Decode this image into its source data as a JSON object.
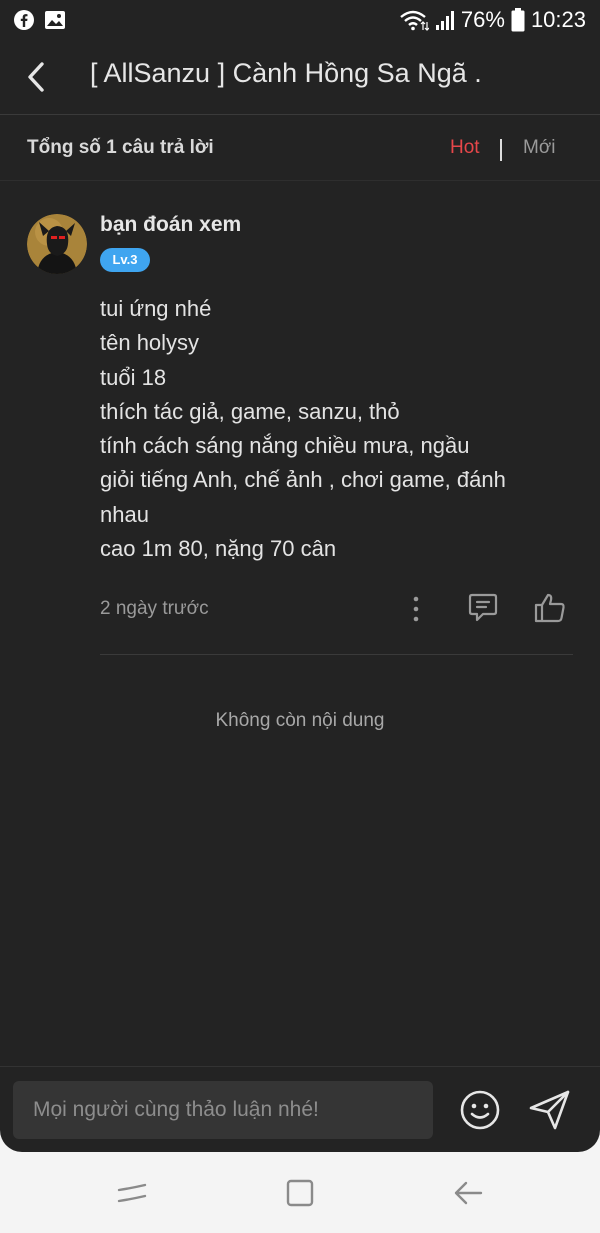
{
  "status_bar": {
    "battery": "76%",
    "time": "10:23",
    "left_icons": [
      "facebook-icon",
      "gallery-icon"
    ],
    "right_icons": [
      "wifi-icon",
      "signal-icon",
      "battery-icon"
    ]
  },
  "app_bar": {
    "title": "[ AllSanzu ] Cành Hồng Sa Ngã ."
  },
  "answers_bar": {
    "total": "Tổng số 1 câu trả lời",
    "sort_hot": "Hot",
    "sort_new": "Mới",
    "active_sort_color": "#e8474a"
  },
  "answer": {
    "username": "bạn đoán xem",
    "level": "Lv.3",
    "level_color": "#3fa5f0",
    "lines": [
      "tui ứng nhé",
      "tên holysy",
      "tuổi 18",
      "thích tác giả, game, sanzu, thỏ",
      "tính cách sáng nắng chiều mưa, ngầu",
      "giỏi tiếng Anh, chế ảnh , chơi game, đánh",
      "nhau",
      "cao 1m 80, nặng 70 cân"
    ],
    "time": "2 ngày trước"
  },
  "end_message": "Không còn nội dung",
  "composer": {
    "placeholder": "Mọi người cùng thảo luận nhé!"
  }
}
